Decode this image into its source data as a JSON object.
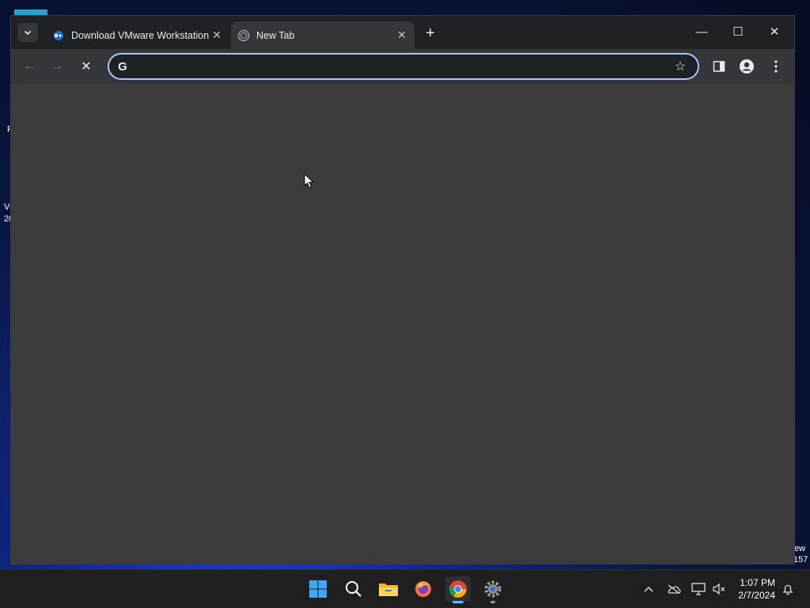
{
  "browser": {
    "tabs": [
      {
        "title": "Download VMware Workstation",
        "close": "✕",
        "favicon": "vmware-icon"
      },
      {
        "title": "New Tab",
        "close": "✕",
        "favicon": "loading-globe-icon"
      }
    ],
    "new_tab_label": "+",
    "window_controls": {
      "minimize": "—",
      "maximize": "☐",
      "close": "✕"
    },
    "toolbar": {
      "back": "←",
      "forward": "→",
      "stop": "✕",
      "omnibox_value": "",
      "omnibox_placeholder": "",
      "bookmark_star": "☆"
    }
  },
  "desktop": {
    "left_labels": [
      "R",
      "Vi",
      "20"
    ],
    "right_labels": [
      "ew",
      "157"
    ]
  },
  "taskbar": {
    "apps": [
      "start-icon",
      "search-icon",
      "file-explorer-icon",
      "firefox-icon",
      "chrome-icon",
      "settings-icon"
    ],
    "tray": [
      "chevron-up-icon",
      "onedrive-icon",
      "network-icon",
      "volume-muted-icon",
      "notification-icon"
    ],
    "time": "1:07 PM",
    "date": "2/7/2024"
  },
  "colors": {
    "accent": "#a8c7fa",
    "taskbar_active": "#4cc2ff",
    "content_bg": "#3c3c3c"
  }
}
